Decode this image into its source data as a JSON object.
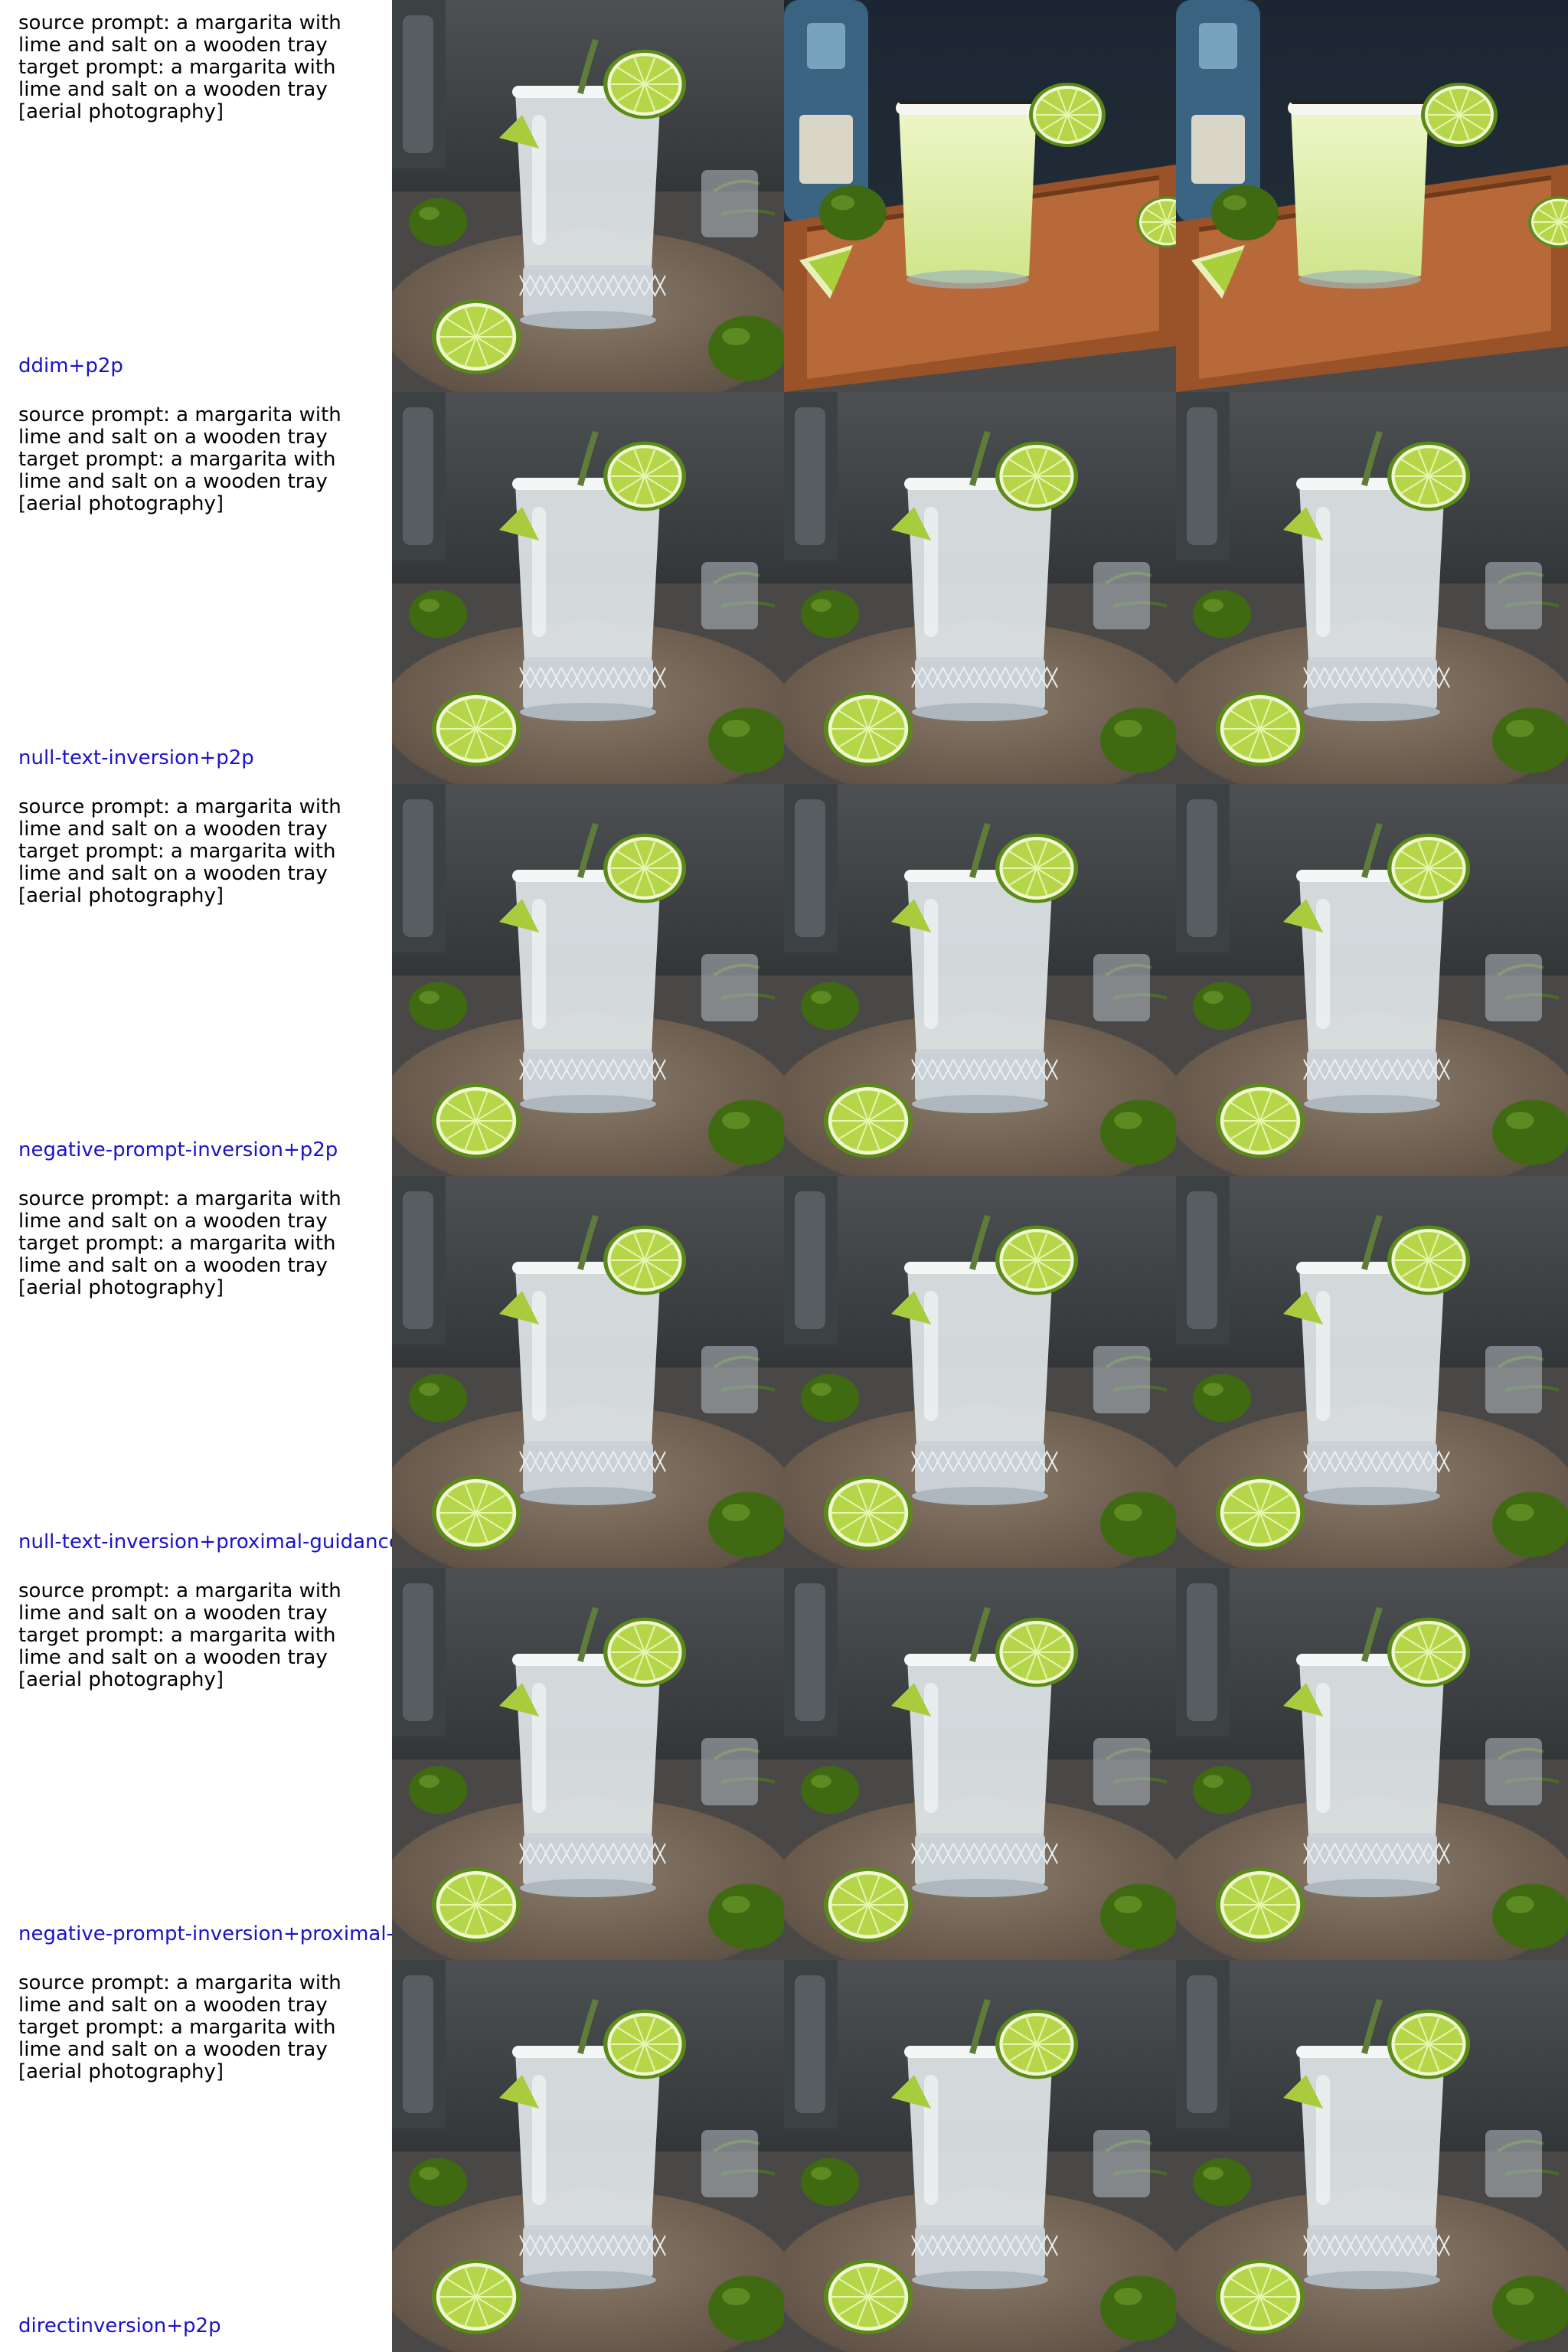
{
  "rows": [
    {
      "source_prompt": "source prompt: a margarita with lime and salt on a wooden tray",
      "target_prompt": "target prompt: a margarita with lime and salt on a wooden tray [aerial photography]",
      "method": "ddim+p2p",
      "images": [
        {
          "alt": "source reconstruction: margarita on round wooden board",
          "scene": "dark"
        },
        {
          "alt": "edited: margarita on rectangular wooden tray",
          "scene": "tray"
        },
        {
          "alt": "edited: margarita on rectangular wooden tray",
          "scene": "tray"
        }
      ]
    },
    {
      "source_prompt": "source prompt: a margarita with lime and salt on a wooden tray",
      "target_prompt": "target prompt: a margarita with lime and salt on a wooden tray [aerial photography]",
      "method": "null-text-inversion+p2p",
      "images": [
        {
          "alt": "source image",
          "scene": "dark"
        },
        {
          "alt": "reconstruction",
          "scene": "dark"
        },
        {
          "alt": "edited",
          "scene": "dark"
        }
      ]
    },
    {
      "source_prompt": "source prompt: a margarita with lime and salt on a wooden tray",
      "target_prompt": "target prompt: a margarita with lime and salt on a wooden tray [aerial photography]",
      "method": "negative-prompt-inversion+p2p",
      "images": [
        {
          "alt": "source image",
          "scene": "dark"
        },
        {
          "alt": "reconstruction",
          "scene": "dark"
        },
        {
          "alt": "edited",
          "scene": "dark"
        }
      ]
    },
    {
      "source_prompt": "source prompt: a margarita with lime and salt on a wooden tray",
      "target_prompt": "target prompt: a margarita with lime and salt on a wooden tray [aerial photography]",
      "method": "null-text-inversion+proximal-guidance",
      "images": [
        {
          "alt": "source image",
          "scene": "dark"
        },
        {
          "alt": "reconstruction",
          "scene": "dark"
        },
        {
          "alt": "edited",
          "scene": "dark"
        }
      ]
    },
    {
      "source_prompt": "source prompt: a margarita with lime and salt on a wooden tray",
      "target_prompt": "target prompt: a margarita with lime and salt on a wooden tray [aerial photography]",
      "method": "negative-prompt-inversion+proximal-g",
      "images": [
        {
          "alt": "source image",
          "scene": "dark"
        },
        {
          "alt": "reconstruction",
          "scene": "dark"
        },
        {
          "alt": "edited",
          "scene": "dark"
        }
      ]
    },
    {
      "source_prompt": "source prompt: a margarita with lime and salt on a wooden tray",
      "target_prompt": "target prompt: a margarita with lime and salt on a wooden tray [aerial photography]",
      "method": "directinversion+p2p",
      "images": [
        {
          "alt": "source image",
          "scene": "dark"
        },
        {
          "alt": "reconstruction",
          "scene": "dark"
        },
        {
          "alt": "edited",
          "scene": "dark"
        }
      ]
    }
  ],
  "colors": {
    "prompt_text": "#000000",
    "method_text": "#1a12c8",
    "background": "#ffffff"
  }
}
